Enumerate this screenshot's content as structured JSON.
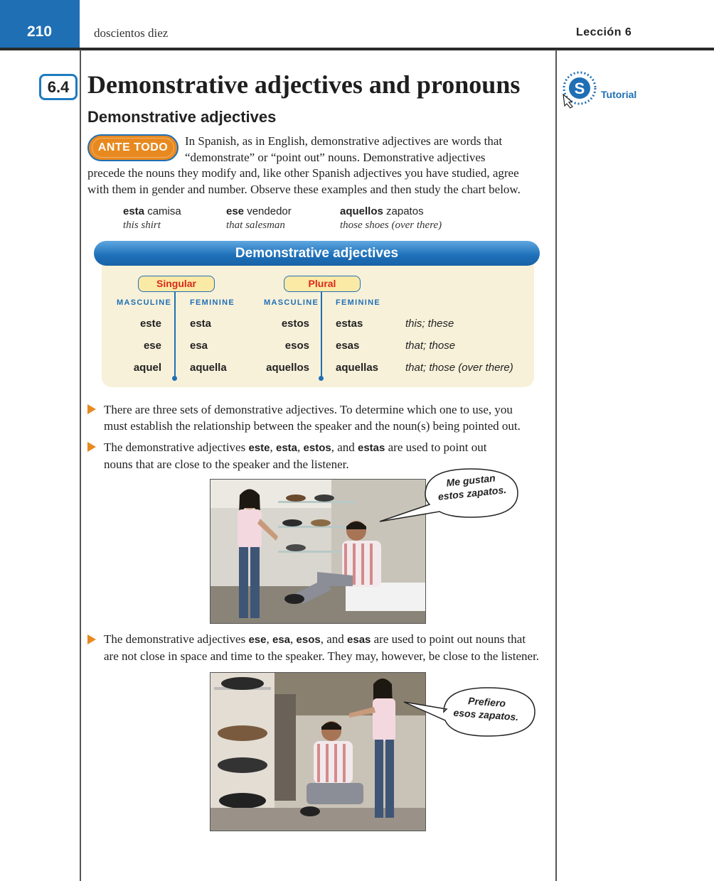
{
  "header": {
    "page_number": "210",
    "page_words": "doscientos diez",
    "lesson": "Lección 6"
  },
  "section": {
    "number": "6.4",
    "title": "Demonstrative adjectives and pronouns",
    "tutorial_label": "Tutorial",
    "subtitle": "Demonstrative adjectives"
  },
  "intro": {
    "badge": "ANTE TODO",
    "line1": "In Spanish, as in English, demonstrative adjectives are words that",
    "line2": "“demonstrate” or “point out” nouns. Demonstrative adjectives",
    "line3": "precede the nouns they modify and, like other Spanish adjectives you have studied, agree",
    "line4": "with them in gender and number. Observe these examples and then study the chart below."
  },
  "examples": [
    {
      "demonstrative": "esta",
      "noun": " camisa",
      "english": "this shirt"
    },
    {
      "demonstrative": "ese",
      "noun": " vendedor",
      "english": "that salesman"
    },
    {
      "demonstrative": "aquellos",
      "noun": " zapatos",
      "english": "those shoes (over there)"
    }
  ],
  "chart": {
    "title": "Demonstrative adjectives",
    "singular_label": "Singular",
    "plural_label": "Plural",
    "col_masculine": "MASCULINE",
    "col_feminine": "FEMININE",
    "rows": [
      {
        "sing_masc": "este",
        "sing_fem": "esta",
        "pl_masc": "estos",
        "pl_fem": "estas",
        "english": "this; these"
      },
      {
        "sing_masc": "ese",
        "sing_fem": "esa",
        "pl_masc": "esos",
        "pl_fem": "esas",
        "english": "that; those"
      },
      {
        "sing_masc": "aquel",
        "sing_fem": "aquella",
        "pl_masc": "aquellos",
        "pl_fem": "aquellas",
        "english": "that; those (over there)"
      }
    ]
  },
  "bullets": {
    "b1_line1": "There are three sets of demonstrative adjectives. To determine which one to use, you",
    "b1_line2": "must establish the relationship between the speaker and the noun(s) being pointed out.",
    "b2_pre": "The demonstrative adjectives ",
    "b2_w1": "este",
    "b2_w2": "esta",
    "b2_w3": "estos",
    "b2_and": ", and ",
    "b2_w4": "estas",
    "b2_post": " are used to point out",
    "b2_line2": "nouns that are close to the speaker and the listener.",
    "b3_pre": "The demonstrative adjectives ",
    "b3_w1": "ese",
    "b3_w2": "esa",
    "b3_w3": "esos",
    "b3_and": ", and ",
    "b3_w4": "esas",
    "b3_post": " are used to point out nouns that",
    "b3_line2": "are not close in space and time to the speaker. They may, however, be close to the listener.",
    "comma": ", "
  },
  "speech": {
    "bubble1_line1": "Me gustan",
    "bubble1_line2": "estos zapatos.",
    "bubble2_line1": "Prefiero",
    "bubble2_line2": "esos zapatos."
  },
  "colors": {
    "header_blue": "#1f6fb5",
    "accent_orange": "#e8891f",
    "pill_red": "#d82a1c",
    "chart_cream": "#f7f1da"
  }
}
